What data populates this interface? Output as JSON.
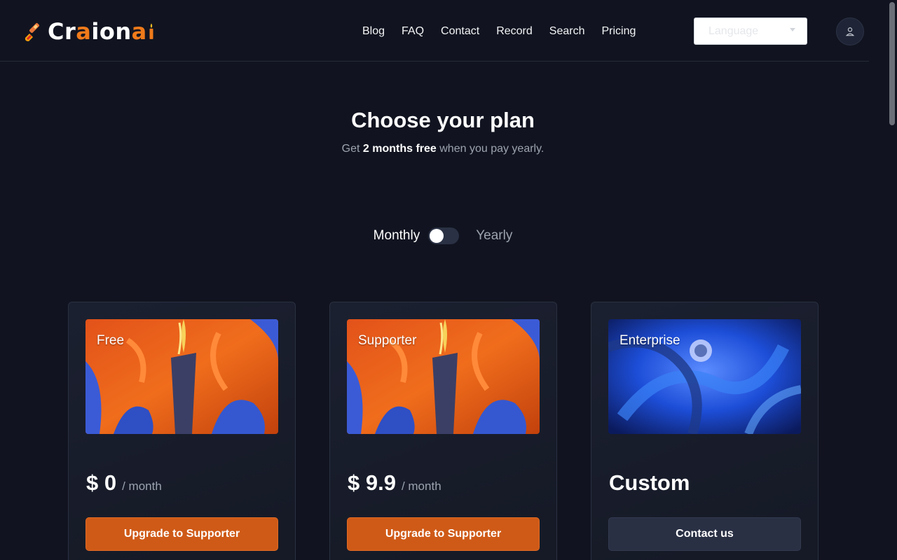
{
  "header": {
    "logo_text_prefix": "Cr",
    "logo_text_a": "a",
    "logo_text_mid": "ion",
    "logo_text_a2": "a",
    "nav": [
      {
        "label": "Blog"
      },
      {
        "label": "FAQ"
      },
      {
        "label": "Contact"
      },
      {
        "label": "Record"
      },
      {
        "label": "Search"
      },
      {
        "label": "Pricing"
      }
    ],
    "language_placeholder": "Language"
  },
  "hero": {
    "title": "Choose your plan",
    "subtitle_pre": "Get",
    "subtitle_bold": "2 months free",
    "subtitle_post": "when you pay yearly."
  },
  "billing_toggle": {
    "left_label": "Monthly",
    "right_label": "Yearly",
    "selected": "Monthly"
  },
  "plans": [
    {
      "name": "Free",
      "price": "$ 0",
      "unit": "/ month",
      "button": "Upgrade to Supporter"
    },
    {
      "name": "Supporter",
      "price": "$ 9.9",
      "unit": "/ month",
      "button": "Upgrade to Supporter"
    },
    {
      "name": "Enterprise",
      "price": "Custom",
      "unit": "",
      "button": "Contact us"
    }
  ],
  "colors": {
    "background": "#111420",
    "accent_orange": "#cf5a17",
    "card": "#1b2030"
  }
}
